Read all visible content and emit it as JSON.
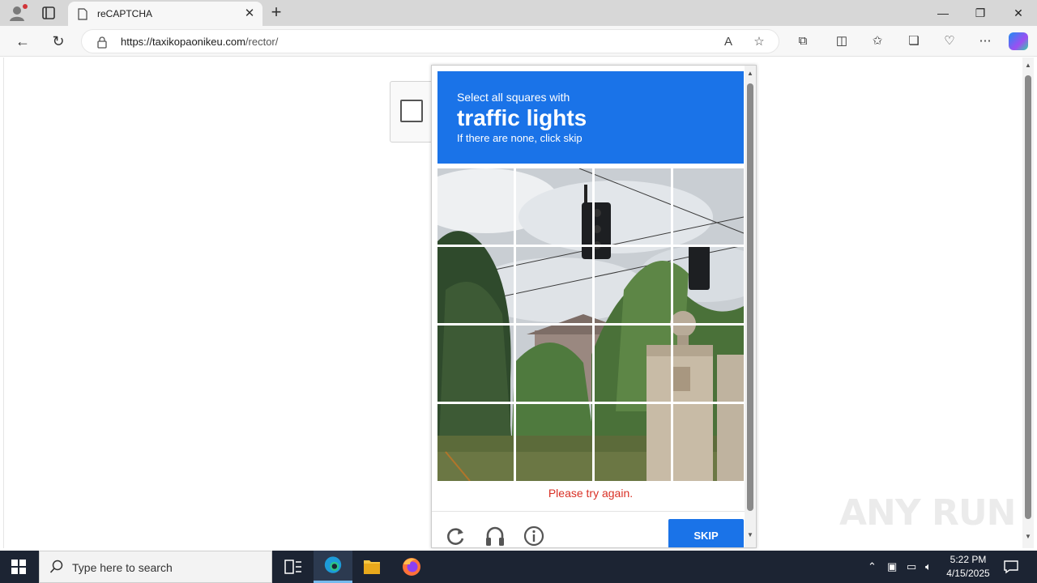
{
  "browser": {
    "tab_title": "reCAPTCHA",
    "url_host": "https://taxikopaonikeu.com",
    "url_path": "/rector/"
  },
  "challenge": {
    "instruction_small": "Select all squares with",
    "instruction_target": "traffic lights",
    "instruction_sub": "If there are none, click skip",
    "error_text": "Please try again.",
    "skip_label": "SKIP"
  },
  "watermark": "ANY RUN",
  "taskbar": {
    "search_placeholder": "Type here to search",
    "time": "5:22 PM",
    "date": "4/15/2025"
  },
  "colors": {
    "header_blue": "#1a73e8",
    "error_red": "#d93025",
    "taskbar": "#1c2433"
  }
}
